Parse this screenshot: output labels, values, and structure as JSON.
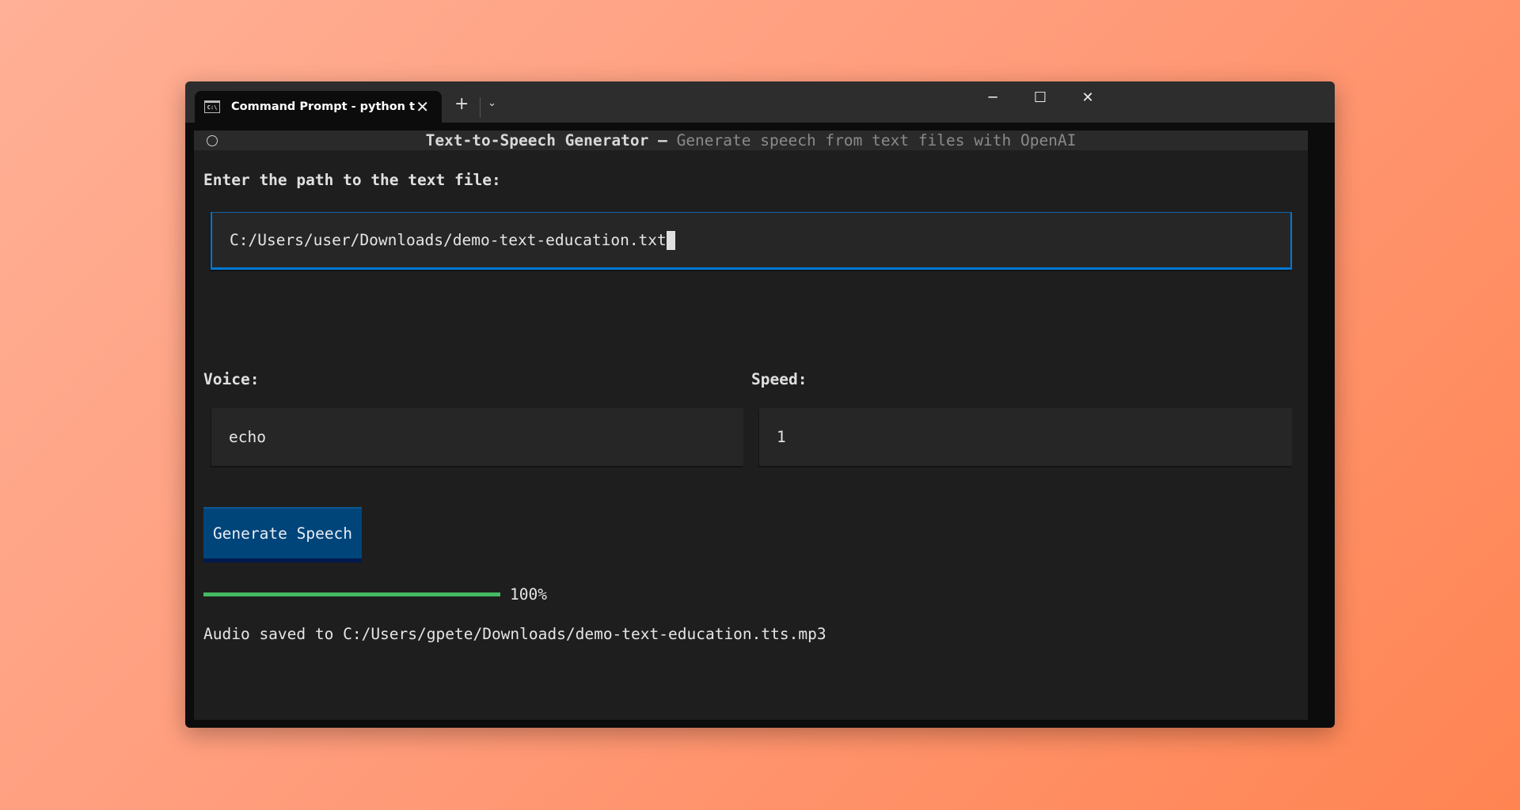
{
  "window": {
    "tab_title": "Command Prompt - python t",
    "tab_icon": "cmd-icon",
    "new_tab": "+",
    "dropdown": "⌄",
    "minimize": "─",
    "maximize": "☐",
    "close": "✕"
  },
  "app": {
    "title": "Text-to-Speech Generator",
    "separator": " – ",
    "subtitle": "Generate speech from text files with OpenAI",
    "path_label": "Enter the path to the text file:",
    "path_value": "C:/Users/user/Downloads/demo-text-education.txt",
    "voice_label": "Voice:",
    "voice_value": "echo",
    "speed_label": "Speed:",
    "speed_value": "1",
    "generate_button": "Generate Speech",
    "progress_percent": 100,
    "progress_label": "100%",
    "status": "Audio saved to C:/Users/gpete/Downloads/demo-text-education.tts.mp3"
  },
  "colors": {
    "accent": "#0078d4",
    "button": "#00457a",
    "progress": "#45b964"
  }
}
